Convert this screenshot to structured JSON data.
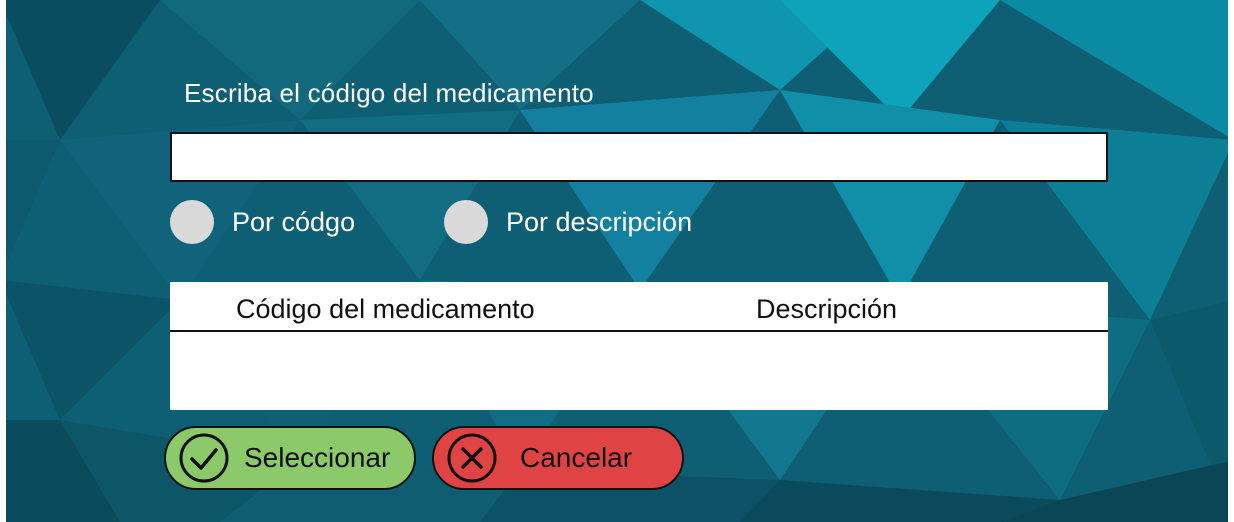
{
  "form": {
    "prompt": "Escriba el código del medicamento",
    "code_value": "",
    "radio_options": [
      {
        "label": "Por códgo"
      },
      {
        "label": "Por descripción"
      }
    ]
  },
  "results_table": {
    "columns": [
      "Código del medicamento",
      "Descripción"
    ],
    "rows": []
  },
  "actions": {
    "select_label": "Seleccionar",
    "cancel_label": "Cancelar"
  },
  "colors": {
    "background": "#0f5f74",
    "select_button": "#8cc96a",
    "cancel_button": "#e04343",
    "radio_fill": "#d9d9d9"
  },
  "icons": {
    "select": "check-circle-icon",
    "cancel": "x-circle-icon"
  }
}
